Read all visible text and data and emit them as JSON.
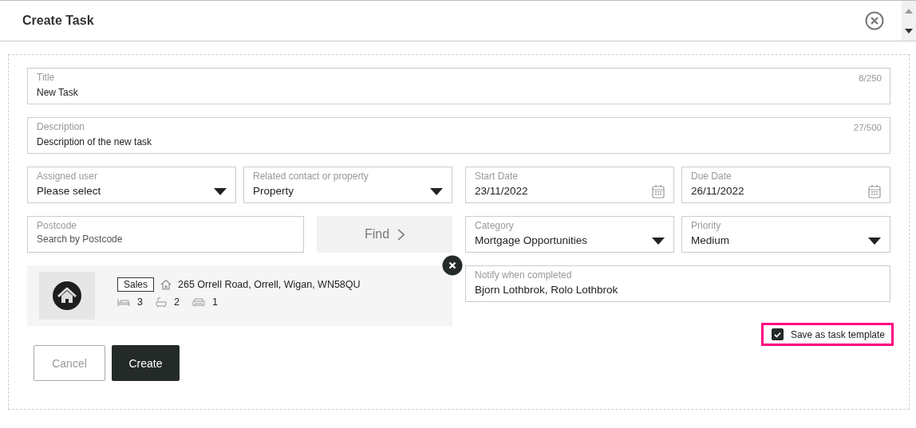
{
  "dialog": {
    "title": "Create Task"
  },
  "title_field": {
    "label": "Title",
    "value": "New Task",
    "counter": "8/250"
  },
  "description_field": {
    "label": "Description",
    "value": "Description of the new task",
    "counter": "27/500"
  },
  "assigned_user": {
    "label": "Assigned user",
    "value": "Please select"
  },
  "related_contact": {
    "label": "Related contact or property",
    "value": "Property"
  },
  "start_date": {
    "label": "Start Date",
    "value": "23/11/2022"
  },
  "due_date": {
    "label": "Due Date",
    "value": "26/11/2022"
  },
  "postcode": {
    "label": "Postcode",
    "placeholder": "Search by Postcode"
  },
  "find_button": {
    "label": "Find",
    "disabled": true
  },
  "category": {
    "label": "Category",
    "value": "Mortgage Opportunities"
  },
  "priority": {
    "label": "Priority",
    "value": "Medium"
  },
  "property_card": {
    "tag": "Sales",
    "address": "265 Orrell Road, Orrell, Wigan, WN58QU",
    "bedrooms": "3",
    "bathrooms": "2",
    "parking": "1"
  },
  "notify": {
    "label": "Notify when completed",
    "value": "Bjorn Lothbrok, Rolo Lothbrok"
  },
  "save_template": {
    "label": "Save as task template",
    "checked": true,
    "highlighted": true
  },
  "buttons": [
    {
      "kind": "secondary",
      "label": "Cancel"
    },
    {
      "kind": "primary",
      "label": "Create"
    }
  ]
}
